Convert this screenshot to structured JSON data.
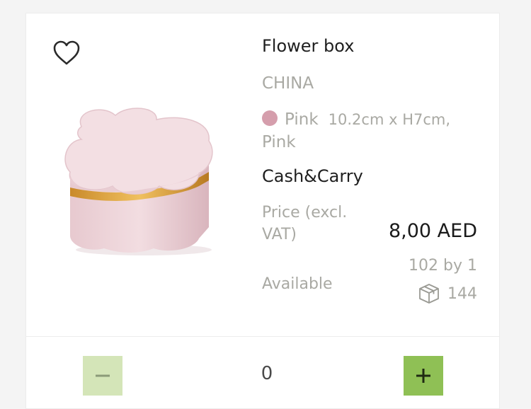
{
  "product": {
    "name": "Flower box",
    "country": "CHINA",
    "color_name": "Pink",
    "color_swatch": "#d59eac",
    "description_line1": "10.2cm x H7cm,",
    "description_line2": "Pink",
    "channel": "Cash&Carry",
    "price_label": "Price (excl. VAT)",
    "price_value": "8,00 AED",
    "stock_text": "102 by 1",
    "availability_label": "Available",
    "pack_count": "144"
  },
  "quantity": {
    "value": "0",
    "minus_color": "#d4e5b8",
    "plus_color": "#8fc055"
  },
  "icons": {
    "favorite": "heart-outline-icon",
    "package": "box-icon",
    "minus": "minus-icon",
    "plus": "plus-icon"
  }
}
